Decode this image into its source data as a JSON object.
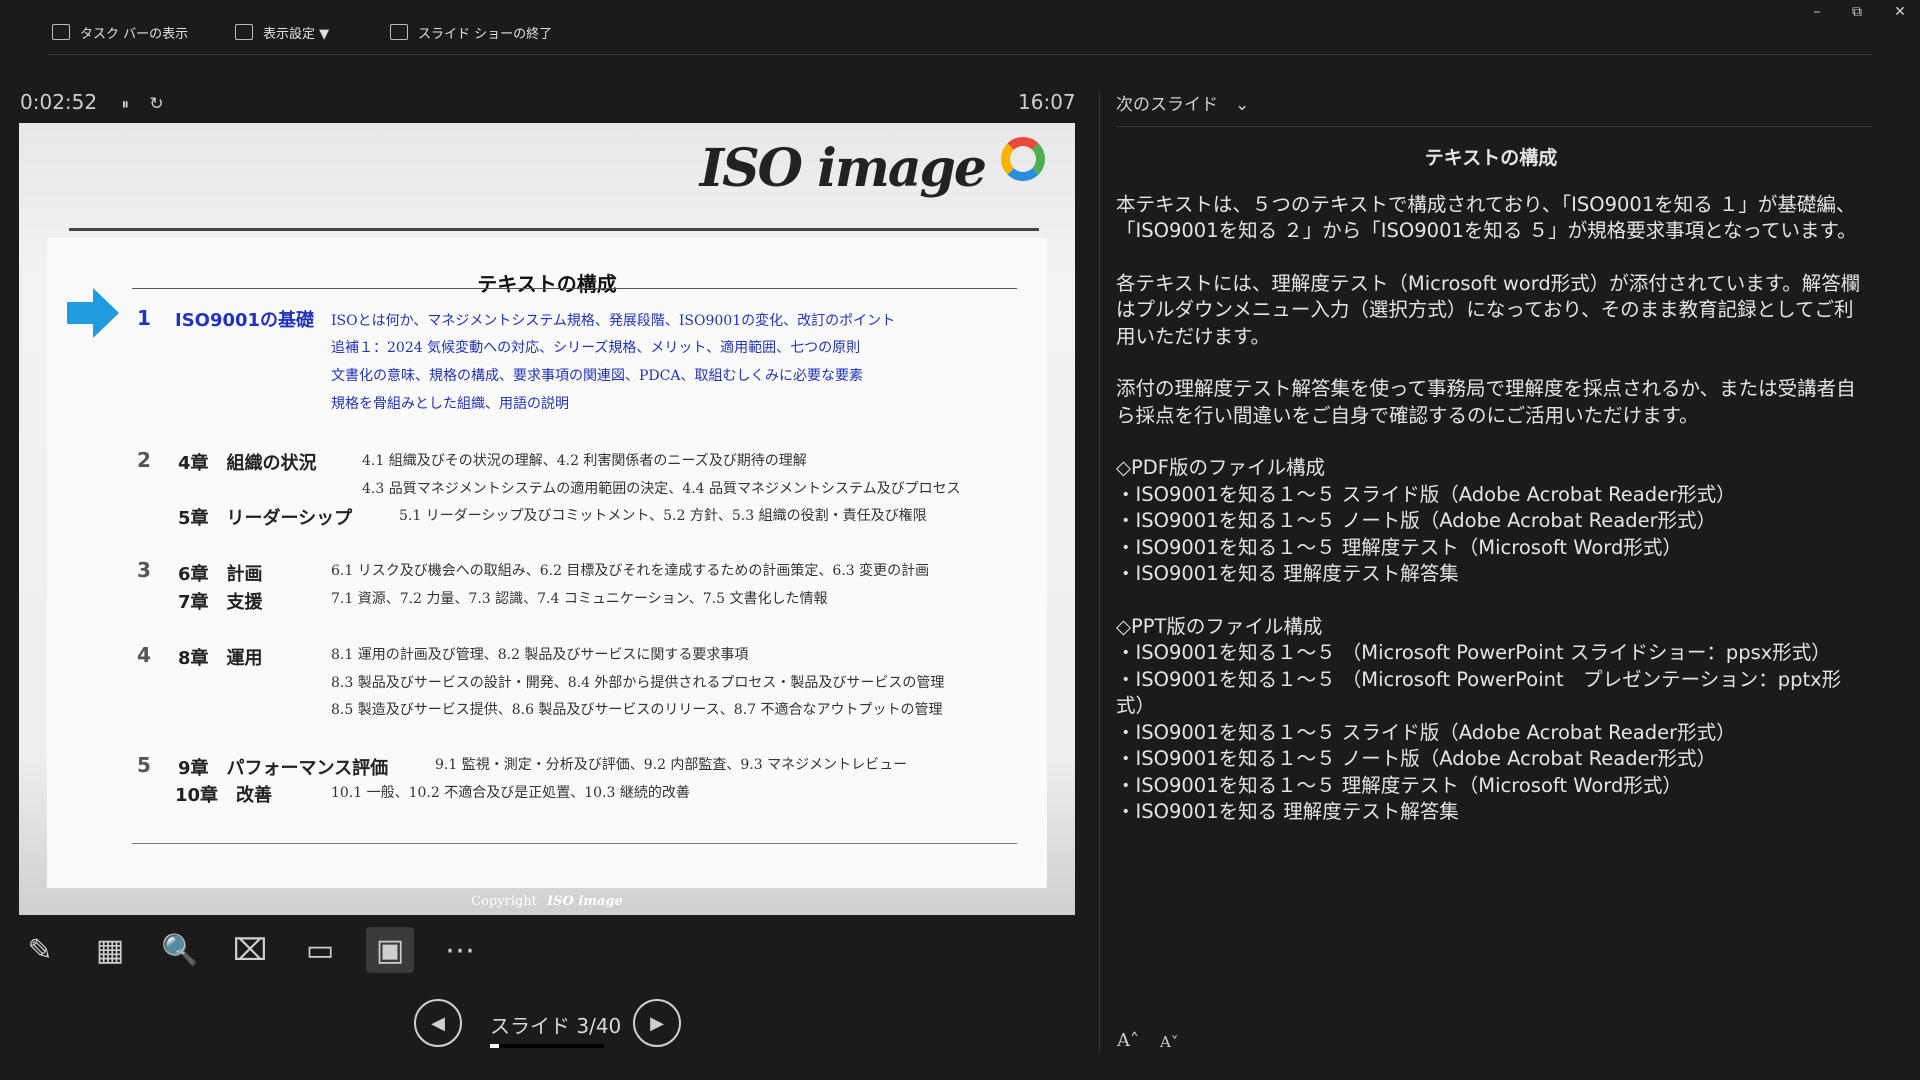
{
  "toolbar": {
    "taskbar_label": "タスク バーの表示",
    "display_label": "表示設定 ▼",
    "end_label": "スライド ショーの終了"
  },
  "window": {
    "minimize": "–",
    "restore": "⧉",
    "close": "✕"
  },
  "presenter": {
    "elapsed": "0:02:52",
    "pause_icon": "⏸",
    "reset_icon": "↻",
    "clock": "16:07",
    "slide_counter": "スライド 3/40",
    "progress_fraction": 0.075
  },
  "slide": {
    "logo": "ISO image",
    "title": "テキストの構成",
    "rows": [
      {
        "num": "1",
        "chapter": "ISO9001の基礎",
        "lines": [
          "ISOとは何か、マネジメントシステム規格、発展段階、ISO9001の変化、改訂のポイント",
          "追補１：2024 気候変動への対応、シリーズ規格、メリット、適用範囲、七つの原則",
          "文書化の意味、規格の構成、要求事項の関連図、PDCA、取組むしくみに必要な要素",
          "規格を骨組みとした組織、用語の説明"
        ]
      },
      {
        "num": "2",
        "chapter_a": "4章　組織の状況",
        "lines_a": [
          "4.1 組織及びその状況の理解、4.2 利害関係者のニーズ及び期待の理解",
          "4.3 品質マネジメントシステムの適用範囲の決定、4.4 品質マネジメントシステム及びプロセス"
        ],
        "chapter_b": "5章　リーダーシップ",
        "lines_b": [
          "5.1 リーダーシップ及びコミットメント、5.2 方針、5.3 組織の役割・責任及び権限"
        ]
      },
      {
        "num": "3",
        "chapter_a": "6章　計画",
        "lines_a": [
          "6.1 リスク及び機会への取組み、6.2 目標及びそれを達成するための計画策定、6.3 変更の計画"
        ],
        "chapter_b": "7章　支援",
        "lines_b": [
          "7.1 資源、7.2 力量、7.3 認識、7.4 コミュニケーション、7.5 文書化した情報"
        ]
      },
      {
        "num": "4",
        "chapter": "8章　運用",
        "lines": [
          "8.1 運用の計画及び管理、8.2 製品及びサービスに関する要求事項",
          "8.3 製品及びサービスの設計・開発、8.4 外部から提供されるプロセス・製品及びサービスの管理",
          "8.5 製造及びサービス提供、8.6 製品及びサービスのリリース、8.7 不適合なアウトプットの管理"
        ]
      },
      {
        "num": "5",
        "chapter_a": "9章　パフォーマンス評価",
        "lines_a": [
          "9.1 監視・測定・分析及び評価、9.2 内部監査、9.3 マネジメントレビュー"
        ],
        "chapter_b": "10章　改善",
        "lines_b": [
          "10.1 一般、10.2 不適合及び是正処置、10.3 継続的改善"
        ]
      }
    ],
    "copyright": "Copyright",
    "copyright_logo": "ISO image"
  },
  "tools": [
    {
      "name": "pen-tool-icon",
      "glyph": "✎"
    },
    {
      "name": "see-all-slides-icon",
      "glyph": "▦"
    },
    {
      "name": "zoom-icon",
      "glyph": "🔍"
    },
    {
      "name": "black-screen-icon",
      "glyph": "⌧"
    },
    {
      "name": "subtitles-icon",
      "glyph": "▭"
    },
    {
      "name": "camera-icon",
      "glyph": "▣"
    },
    {
      "name": "more-options-icon",
      "glyph": "⋯"
    }
  ],
  "nav": {
    "prev": "◀",
    "next": "▶"
  },
  "notes_pane": {
    "header": "次のスライド　⌄",
    "title": "テキストの構成",
    "p1": "本テキストは、５つのテキストで構成されており、「ISO9001を知る １」が基礎編、「ISO9001を知る ２」から「ISO9001を知る ５」が規格要求事項となっています。",
    "p2": "各テキストには、理解度テスト（Microsoft word形式）が添付されています。解答欄はプルダウンメニュー入力（選択方式）になっており、そのまま教育記録としてご利用いただけます。",
    "p3": "添付の理解度テスト解答集を使って事務局で理解度を採点されるか、または受講者自ら採点を行い間違いをご自身で確認するのにご活用いただけます。",
    "pdf_header": "◇PDF版のファイル構成",
    "pdf_items": [
      "・ISO9001を知る１～５ スライド版（Adobe Acrobat Reader形式）",
      "・ISO9001を知る１～５ ノート版（Adobe Acrobat Reader形式）",
      "・ISO9001を知る１～５ 理解度テスト（Microsoft Word形式）",
      "・ISO9001を知る 理解度テスト解答集"
    ],
    "ppt_header": "◇PPT版のファイル構成",
    "ppt_items": [
      "・ISO9001を知る１～５ （Microsoft PowerPoint スライドショー：ppsx形式）",
      "・ISO9001を知る１～５ （Microsoft PowerPoint　プレゼンテーション：pptx形式）",
      "・ISO9001を知る１～５ スライド版（Adobe Acrobat Reader形式）",
      "・ISO9001を知る１～５ ノート版（Adobe Acrobat Reader形式）",
      "・ISO9001を知る１～５ 理解度テスト（Microsoft Word形式）",
      "・ISO9001を知る 理解度テスト解答集"
    ],
    "font_up": "A˄",
    "font_down": "A˅"
  }
}
